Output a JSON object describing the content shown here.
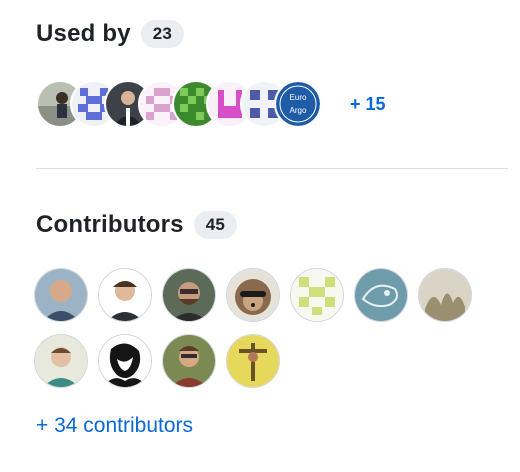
{
  "used_by": {
    "title": "Used by",
    "count": "23",
    "avatars": [
      {
        "name": "user-photo-avatar"
      },
      {
        "name": "blue-identicon-avatar"
      },
      {
        "name": "man-in-suit-avatar"
      },
      {
        "name": "pink-identicon-avatar"
      },
      {
        "name": "green-identicon-avatar"
      },
      {
        "name": "magenta-identicon-avatar"
      },
      {
        "name": "navy-identicon-avatar"
      },
      {
        "name": "euro-argo-logo-avatar",
        "text_top": "Euro",
        "text_bottom": "Argo"
      }
    ],
    "more": "+ 15"
  },
  "contributors": {
    "title": "Contributors",
    "count": "45",
    "avatars": [
      {
        "name": "smiling-man-avatar"
      },
      {
        "name": "young-man-avatar"
      },
      {
        "name": "bearded-man-sunglasses-avatar"
      },
      {
        "name": "hedgehog-sunglasses-avatar"
      },
      {
        "name": "lime-identicon-avatar"
      },
      {
        "name": "blue-sketch-avatar"
      },
      {
        "name": "dry-grass-avatar"
      },
      {
        "name": "man-in-field-avatar"
      },
      {
        "name": "black-white-portrait-avatar"
      },
      {
        "name": "man-with-glasses-avatar"
      },
      {
        "name": "yellow-figure-avatar"
      }
    ],
    "more_link": "+ 34 contributors"
  },
  "colors": {
    "link": "#0969da",
    "count_bg": "#eaeef2",
    "divider": "#d8dee4"
  }
}
